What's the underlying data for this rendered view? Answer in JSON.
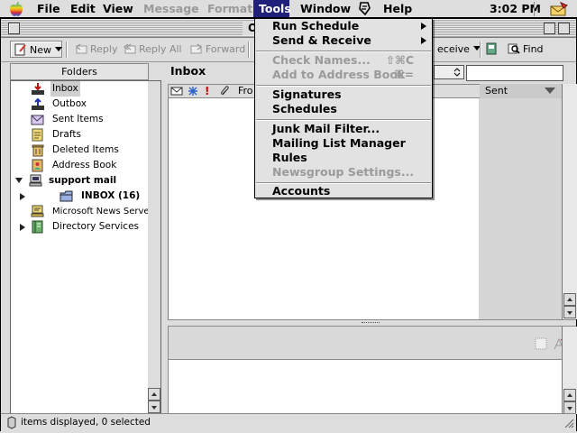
{
  "menubar": {
    "apple_icon": "apple-logo-icon",
    "items": [
      {
        "label": "File",
        "state": "normal"
      },
      {
        "label": "Edit",
        "state": "normal"
      },
      {
        "label": "View",
        "state": "normal"
      },
      {
        "label": "Message",
        "state": "disabled"
      },
      {
        "label": "Format",
        "state": "disabled"
      },
      {
        "label": "Tools",
        "state": "active"
      },
      {
        "label": "Window",
        "state": "normal"
      },
      {
        "label": "Help",
        "state": "normal"
      }
    ],
    "script_icon": "script-icon",
    "clock": "3:02 PM",
    "app_icon": "outlook-express-icon"
  },
  "window": {
    "title_visible_fragment": "O"
  },
  "toolbar": {
    "new_label": "New",
    "reply_label": "Reply",
    "reply_all_label": "Reply All",
    "forward_label": "Forward",
    "send_receive_fragment": "eceive",
    "find_label": "Find"
  },
  "folders": {
    "header": "Folders",
    "items": [
      {
        "label": "Inbox",
        "icon": "inbox-tray-icon",
        "selected": true
      },
      {
        "label": "Outbox",
        "icon": "outbox-tray-icon"
      },
      {
        "label": "Sent Items",
        "icon": "sent-items-icon"
      },
      {
        "label": "Drafts",
        "icon": "drafts-icon"
      },
      {
        "label": "Deleted Items",
        "icon": "trash-icon"
      },
      {
        "label": "Address Book",
        "icon": "address-book-icon"
      }
    ],
    "support_mail": {
      "label": "support mail",
      "icon": "computer-icon",
      "expanded": true
    },
    "inbox_sub": {
      "label": "INBOX (16)",
      "icon": "folder-icon"
    },
    "news_server": {
      "label": "Microsoft News Server",
      "icon": "news-server-icon"
    },
    "directory": {
      "label": "Directory Services",
      "icon": "directory-icon"
    }
  },
  "message_list": {
    "title": "Inbox",
    "from_fragment": "Fro",
    "sent_column": "Sent"
  },
  "status": {
    "text": "items displayed, 0 selected"
  },
  "tools_menu": {
    "items": [
      {
        "label": "Run Schedule",
        "enabled": true,
        "submenu": true
      },
      {
        "label": "Send & Receive",
        "enabled": true,
        "submenu": true
      },
      {
        "label": "Check Names...",
        "enabled": false,
        "shortcut": "⇧⌘C"
      },
      {
        "label": "Add to Address Book",
        "enabled": false,
        "shortcut": "⌘="
      },
      {
        "label": "Signatures",
        "enabled": true
      },
      {
        "label": "Schedules",
        "enabled": true
      },
      {
        "label": "Junk Mail Filter...",
        "enabled": true
      },
      {
        "label": "Mailing List Manager",
        "enabled": true
      },
      {
        "label": "Rules",
        "enabled": true
      },
      {
        "label": "Newsgroup Settings...",
        "enabled": false
      },
      {
        "label": "Accounts",
        "enabled": true
      }
    ]
  },
  "colors": {
    "menu_highlight": "#20207a",
    "disabled_text": "#9a9a9a",
    "selection_gray": "#cfcfcf"
  }
}
